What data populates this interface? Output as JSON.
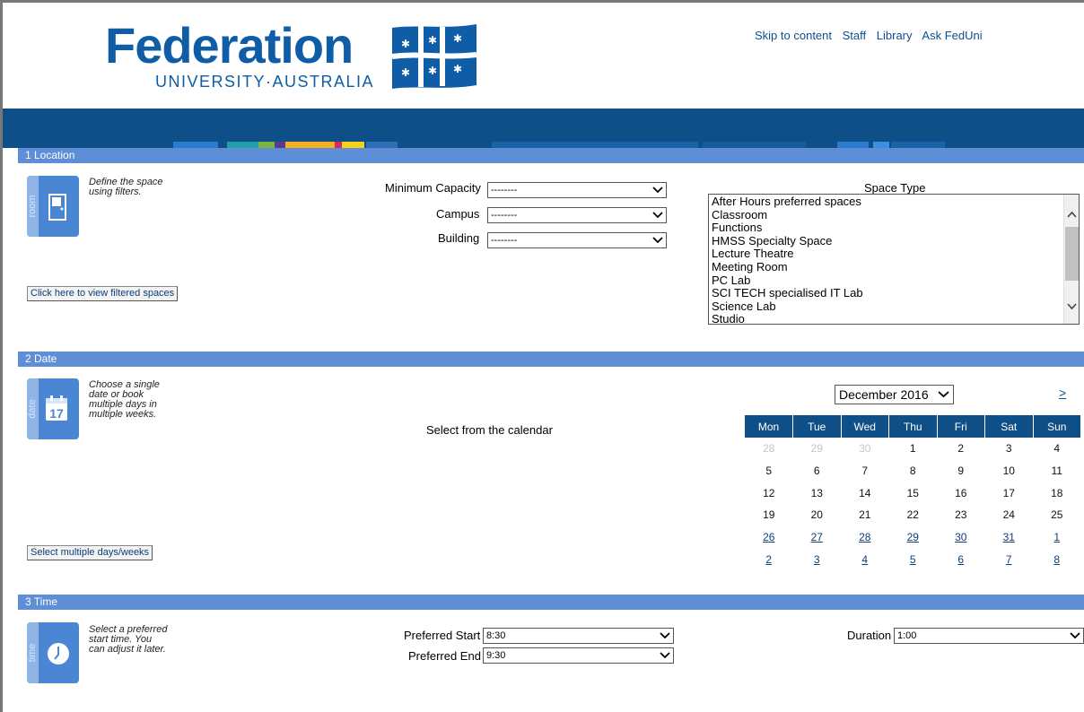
{
  "header": {
    "logo_word": "Federation",
    "logo_sub": "UNIVERSITY·AUSTRALIA",
    "links": [
      "Skip to content",
      "Staff",
      "Library",
      "Ask FedUni"
    ]
  },
  "colors": {
    "brand_blue": "#0e5da6",
    "band": "#0e4f87",
    "section_bar": "#5d8ed6",
    "icon_blue": "#4a86d4"
  },
  "location": {
    "bar_label": "1  Location",
    "icon_label": "room",
    "icon": "door-icon",
    "desc": "Define the space using filters.",
    "filter_button": "Click here to view filtered spaces",
    "min_capacity_label": "Minimum Capacity",
    "min_capacity_value": "--------",
    "campus_label": "Campus",
    "campus_value": "--------",
    "building_label": "Building",
    "building_value": "--------",
    "space_type_label": "Space Type",
    "space_types": [
      "After Hours preferred spaces",
      "Classroom",
      "Functions",
      "HMSS Specialty Space",
      "Lecture Theatre",
      "Meeting Room",
      "PC Lab",
      "SCI TECH specialised IT Lab",
      "Science Lab",
      "Studio"
    ]
  },
  "date": {
    "bar_label": "2  Date",
    "icon_label": "date",
    "icon": "calendar-icon",
    "icon_day": "17",
    "desc": "Choose a single date or book multiple days in multiple weeks.",
    "multi_button": "Select multiple days/weeks",
    "instruction": "Select from the calendar",
    "month": "December 2016",
    "next": ">",
    "weekdays": [
      "Mon",
      "Tue",
      "Wed",
      "Thu",
      "Fri",
      "Sat",
      "Sun"
    ],
    "weeks": [
      [
        {
          "d": "28",
          "s": "prev"
        },
        {
          "d": "29",
          "s": "prev"
        },
        {
          "d": "30",
          "s": "prev"
        },
        {
          "d": "1",
          "s": ""
        },
        {
          "d": "2",
          "s": ""
        },
        {
          "d": "3",
          "s": ""
        },
        {
          "d": "4",
          "s": ""
        }
      ],
      [
        {
          "d": "5",
          "s": ""
        },
        {
          "d": "6",
          "s": ""
        },
        {
          "d": "7",
          "s": ""
        },
        {
          "d": "8",
          "s": ""
        },
        {
          "d": "9",
          "s": ""
        },
        {
          "d": "10",
          "s": ""
        },
        {
          "d": "11",
          "s": ""
        }
      ],
      [
        {
          "d": "12",
          "s": ""
        },
        {
          "d": "13",
          "s": ""
        },
        {
          "d": "14",
          "s": ""
        },
        {
          "d": "15",
          "s": ""
        },
        {
          "d": "16",
          "s": ""
        },
        {
          "d": "17",
          "s": ""
        },
        {
          "d": "18",
          "s": ""
        }
      ],
      [
        {
          "d": "19",
          "s": ""
        },
        {
          "d": "20",
          "s": ""
        },
        {
          "d": "21",
          "s": ""
        },
        {
          "d": "22",
          "s": ""
        },
        {
          "d": "23",
          "s": ""
        },
        {
          "d": "24",
          "s": ""
        },
        {
          "d": "25",
          "s": ""
        }
      ],
      [
        {
          "d": "26",
          "s": "nextm"
        },
        {
          "d": "27",
          "s": "nextm"
        },
        {
          "d": "28",
          "s": "nextm"
        },
        {
          "d": "29",
          "s": "nextm"
        },
        {
          "d": "30",
          "s": "nextm"
        },
        {
          "d": "31",
          "s": "nextm"
        },
        {
          "d": "1",
          "s": "nextm"
        }
      ],
      [
        {
          "d": "2",
          "s": "nextm"
        },
        {
          "d": "3",
          "s": "nextm"
        },
        {
          "d": "4",
          "s": "nextm"
        },
        {
          "d": "5",
          "s": "nextm"
        },
        {
          "d": "6",
          "s": "nextm"
        },
        {
          "d": "7",
          "s": "nextm"
        },
        {
          "d": "8",
          "s": "nextm"
        }
      ]
    ]
  },
  "time": {
    "bar_label": "3  Time",
    "icon_label": "time",
    "icon": "clock-icon",
    "desc": "Select a preferred start time. You can adjust it later.",
    "start_label": "Preferred Start",
    "start_value": "8:30",
    "end_label": "Preferred End",
    "end_value": "9:30",
    "duration_label": "Duration",
    "duration_value": "1:00"
  }
}
